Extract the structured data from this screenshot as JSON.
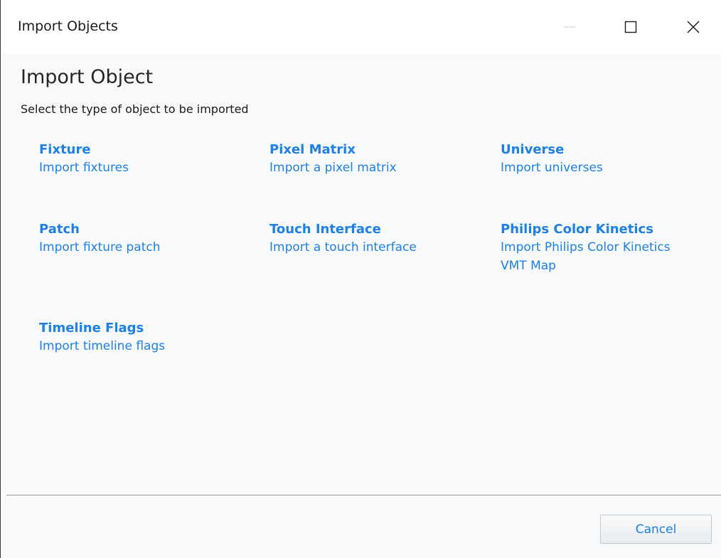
{
  "window": {
    "title": "Import Objects"
  },
  "header": {
    "heading": "Import Object",
    "subheading": "Select the type of object to be imported"
  },
  "options": [
    {
      "title": "Fixture",
      "description": "Import fixtures"
    },
    {
      "title": "Pixel Matrix",
      "description": "Import a pixel matrix"
    },
    {
      "title": "Universe",
      "description": "Import universes"
    },
    {
      "title": "Patch",
      "description": "Import fixture patch"
    },
    {
      "title": "Touch Interface",
      "description": "Import a touch interface"
    },
    {
      "title": "Philips Color Kinetics",
      "description": "Import Philips Color Kinetics VMT Map"
    },
    {
      "title": "Timeline Flags",
      "description": "Import timeline flags"
    }
  ],
  "footer": {
    "cancel_label": "Cancel"
  },
  "icons": {
    "minimize": "minimize-icon",
    "maximize": "maximize-icon",
    "close": "close-icon"
  },
  "colors": {
    "link": "#1d80e2",
    "background": "#f8f9fa",
    "titlebar": "#ffffff"
  }
}
